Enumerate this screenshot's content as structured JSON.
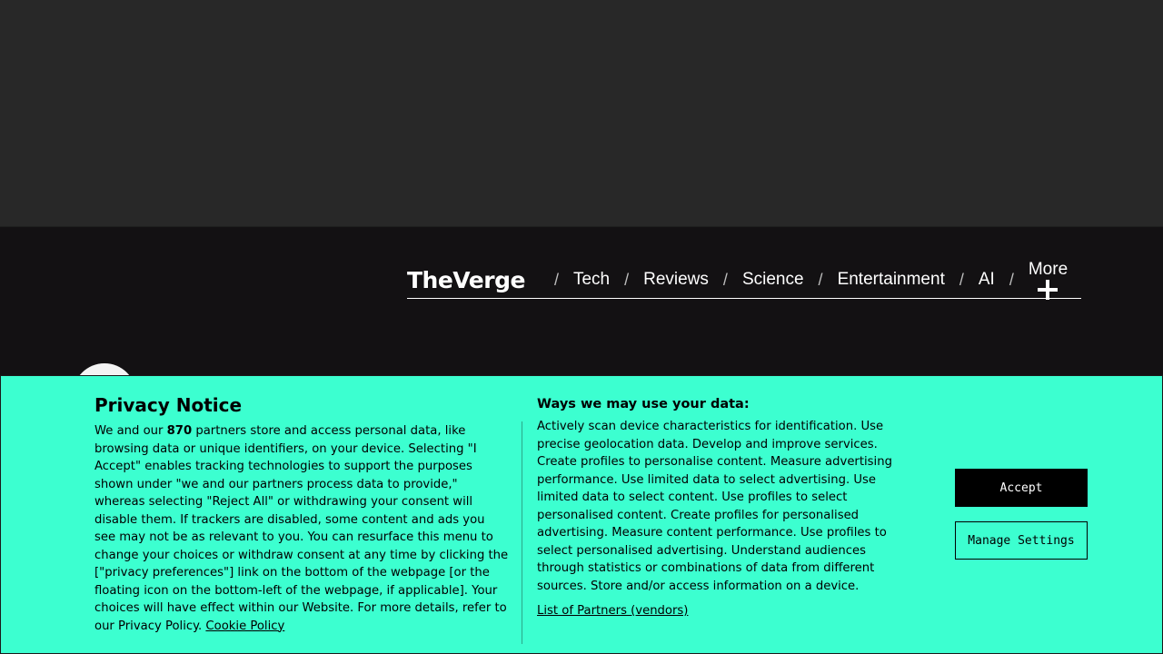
{
  "nav": {
    "logo": "TheVerge",
    "separator": "/",
    "items": [
      {
        "label": "Tech"
      },
      {
        "label": "Reviews"
      },
      {
        "label": "Science"
      },
      {
        "label": "Entertainment"
      },
      {
        "label": "AI"
      },
      {
        "label": "More"
      }
    ],
    "more_icon": "plus-icon"
  },
  "consent": {
    "title": "Privacy Notice",
    "body_prefix": "We and our ",
    "partner_count": "870",
    "body_main": " partners store and access personal data, like browsing data or unique identifiers, on your device. Selecting \"I Accept\" enables tracking technologies to support the purposes shown under \"we and our partners process data to provide,\" whereas selecting \"Reject All\" or withdrawing your consent will disable them. If trackers are disabled, some content and ads you see may not be as relevant to you. You can resurface this menu to change your choices or withdraw consent at any time by clicking the [\"privacy preferences\"] link on the bottom of the webpage [or the floating icon on the bottom-left of the webpage, if applicable]. Your choices will have effect within our Website. For more details, refer to our Privacy Policy. ",
    "cookie_policy_link": "Cookie Policy",
    "uses_title": "Ways we may use your data:",
    "uses_body": "Actively scan device characteristics for identification. Use precise geolocation data. Develop and improve services. Create profiles to personalise content. Measure advertising performance. Use limited data to select advertising. Use limited data to select content. Use profiles to select personalised content. Create profiles for personalised advertising. Measure content performance. Use profiles to select personalised advertising. Understand audiences through statistics or combinations of data from different sources. Store and/or access information on a device.",
    "partners_link": "List of Partners (vendors)",
    "accept_label": "Accept",
    "manage_label": "Manage Settings"
  },
  "colors": {
    "consent_background": "#3cffd0",
    "header_background": "#131113",
    "ad_region_background": "#282828"
  }
}
